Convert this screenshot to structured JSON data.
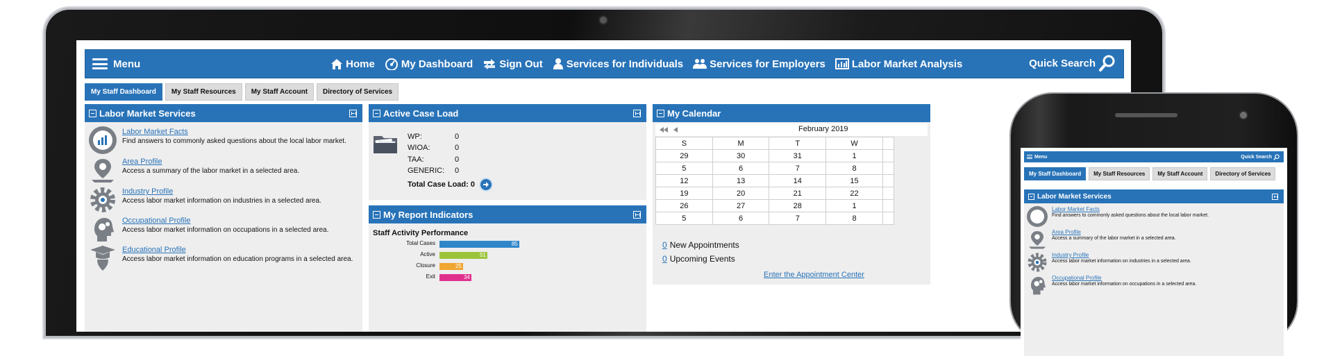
{
  "nav": {
    "menu_label": "Menu",
    "links": [
      {
        "label": "Home",
        "icon": "home-icon"
      },
      {
        "label": "My Dashboard",
        "icon": "dashboard-icon"
      },
      {
        "label": "Sign Out",
        "icon": "sign-out-icon"
      },
      {
        "label": "Services for Individuals",
        "icon": "individual-icon"
      },
      {
        "label": "Services for Employers",
        "icon": "employers-icon"
      },
      {
        "label": "Labor Market Analysis",
        "icon": "chart-icon"
      }
    ],
    "quick_search": "Quick Search"
  },
  "tabs": [
    "My Staff Dashboard",
    "My Staff Resources",
    "My Staff Account",
    "Directory of Services"
  ],
  "labor_market": {
    "title": "Labor Market Services",
    "items": [
      {
        "link": "Labor Market Facts",
        "desc": "Find answers to commonly asked questions about the local labor market.",
        "icon": "labor-facts-icon"
      },
      {
        "link": "Area Profile",
        "desc": "Access a summary of the labor market in a selected area.",
        "icon": "map-pin-icon"
      },
      {
        "link": "Industry Profile",
        "desc": "Access labor market information on industries in a selected area.",
        "icon": "gear-icon"
      },
      {
        "link": "Occupational Profile",
        "desc": "Access labor market information on occupations in a selected area.",
        "icon": "head-gears-icon"
      },
      {
        "link": "Educational Profile",
        "desc": "Access labor market information on education programs in a selected area.",
        "icon": "graduation-icon"
      }
    ]
  },
  "case_load": {
    "title": "Active Case Load",
    "rows": [
      {
        "label": "WP:",
        "value": "0"
      },
      {
        "label": "WIOA:",
        "value": "0"
      },
      {
        "label": "TAA:",
        "value": "0"
      },
      {
        "label": "GENERIC:",
        "value": "0"
      }
    ],
    "total_label": "Total Case Load: 0"
  },
  "report": {
    "title": "My Report Indicators",
    "chart_title": "Staff Activity Performance"
  },
  "chart_data": {
    "type": "bar",
    "orientation": "horizontal",
    "title": "Staff Activity Performance",
    "categories": [
      "Total Cases",
      "Active",
      "Closure",
      "Exit"
    ],
    "values": [
      85,
      51,
      25,
      34
    ],
    "colors": [
      "#2f86c8",
      "#9cc43a",
      "#f0a631",
      "#e0308e"
    ],
    "xlim": [
      0,
      100
    ]
  },
  "calendar": {
    "title": "My Calendar",
    "month": "February 2019",
    "days": [
      "S",
      "M",
      "T",
      "W"
    ],
    "weeks": [
      [
        "29",
        "30",
        "31",
        "1"
      ],
      [
        "5",
        "6",
        "7",
        "8"
      ],
      [
        "12",
        "13",
        "14",
        "15"
      ],
      [
        "19",
        "20",
        "21",
        "22"
      ],
      [
        "26",
        "27",
        "28",
        "1"
      ],
      [
        "5",
        "6",
        "7",
        "8"
      ]
    ],
    "new_appointments_count": "0",
    "new_appointments_label": "New Appointments",
    "upcoming_events_count": "0",
    "upcoming_events_label": "Upcoming Events",
    "appointment_center": "Enter the Appointment Center"
  },
  "phone": {
    "menu_label": "Menu",
    "quick_search": "Quick Search",
    "tabs": [
      "My Staff Dashboard",
      "My Staff Resources",
      "My Staff Account",
      "Directory of Services"
    ],
    "panel_title": "Labor Market Services",
    "items": [
      {
        "link": "Labor Market Facts",
        "desc": "Find answers to commonly asked questions about the local labor market."
      },
      {
        "link": "Area Profile",
        "desc": "Access a summary of the labor market in a selected area."
      },
      {
        "link": "Industry Profile",
        "desc": "Access labor market information on industries in a selected area."
      },
      {
        "link": "Occupational Profile",
        "desc": "Access labor market information on occupations in a selected area."
      }
    ]
  },
  "colors": {
    "primary": "#2873b8",
    "panel_bg": "#eeeeee",
    "tab_bg": "#dcdcdc"
  }
}
